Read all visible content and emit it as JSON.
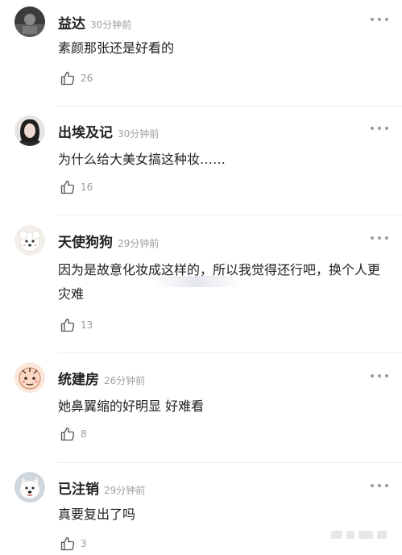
{
  "comments": [
    {
      "username": "益达",
      "time": "30分钟前",
      "text": "素颜那张还是好看的",
      "likes": "26",
      "avatar": "dark-photo-avatar"
    },
    {
      "username": "出埃及记",
      "time": "30分钟前",
      "text": "为什么给大美女搞这种妆……",
      "likes": "16",
      "avatar": "woman-portrait-avatar"
    },
    {
      "username": "天使狗狗",
      "time": "29分钟前",
      "text": "因为是故意化妆成这样的，所以我觉得还行吧，换个人更灾难",
      "likes": "13",
      "avatar": "white-dog-avatar"
    },
    {
      "username": "统建房",
      "time": "26分钟前",
      "text": "她鼻翼缩的好明显 好难看",
      "likes": "8",
      "avatar": "cartoon-face-avatar"
    },
    {
      "username": "已注销",
      "time": "29分钟前",
      "text": "真要复出了吗",
      "likes": "3",
      "avatar": "samoyed-avatar"
    }
  ],
  "icons": {
    "like": "thumbs-up-icon",
    "more": "more-dots-icon"
  },
  "colors": {
    "username": "#222222",
    "time": "#a0a0a0",
    "divider": "#ececec"
  }
}
